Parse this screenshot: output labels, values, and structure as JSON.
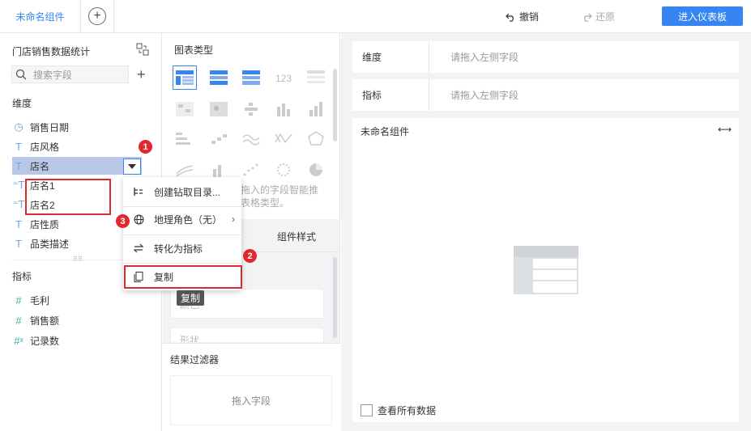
{
  "topbar": {
    "active_tab": "未命名组件",
    "undo_label": "撤销",
    "redo_label": "还原",
    "enter_dashboard": "进入仪表板"
  },
  "left": {
    "dataset_title": "门店销售数据统计",
    "search_placeholder": "搜索字段",
    "dimension_label": "维度",
    "dimensions": [
      "销售日期",
      "店风格",
      "店名",
      "店名1",
      "店名2",
      "店性质",
      "品类描述"
    ],
    "metric_label": "指标",
    "metrics": [
      "毛利",
      "销售额",
      "记录数"
    ]
  },
  "middle": {
    "chart_type_title": "图表类型",
    "hint_line1": "拖入的字段智能推",
    "hint_line2": "表格类型。",
    "tab_style": "组件样式",
    "filter_title": "结果过滤器",
    "filter_drop": "拖入字段",
    "overlap_text": "颜色",
    "overlap_text2": "形状"
  },
  "context_menu": {
    "items": [
      "创建钻取目录...",
      "地理角色（无）",
      "转化为指标",
      "复制"
    ],
    "tooltip": "复制"
  },
  "badges": [
    "1",
    "2",
    "3"
  ],
  "right": {
    "dimension_label": "维度",
    "dimension_placeholder": "请拖入左侧字段",
    "metric_label": "指标",
    "metric_placeholder": "请拖入左侧字段",
    "component_name": "未命名组件",
    "view_all": "查看所有数据"
  },
  "colors": {
    "accent": "#3685f2",
    "highlight": "#e0282e",
    "selected_field_bg": "#b9c8e8"
  }
}
